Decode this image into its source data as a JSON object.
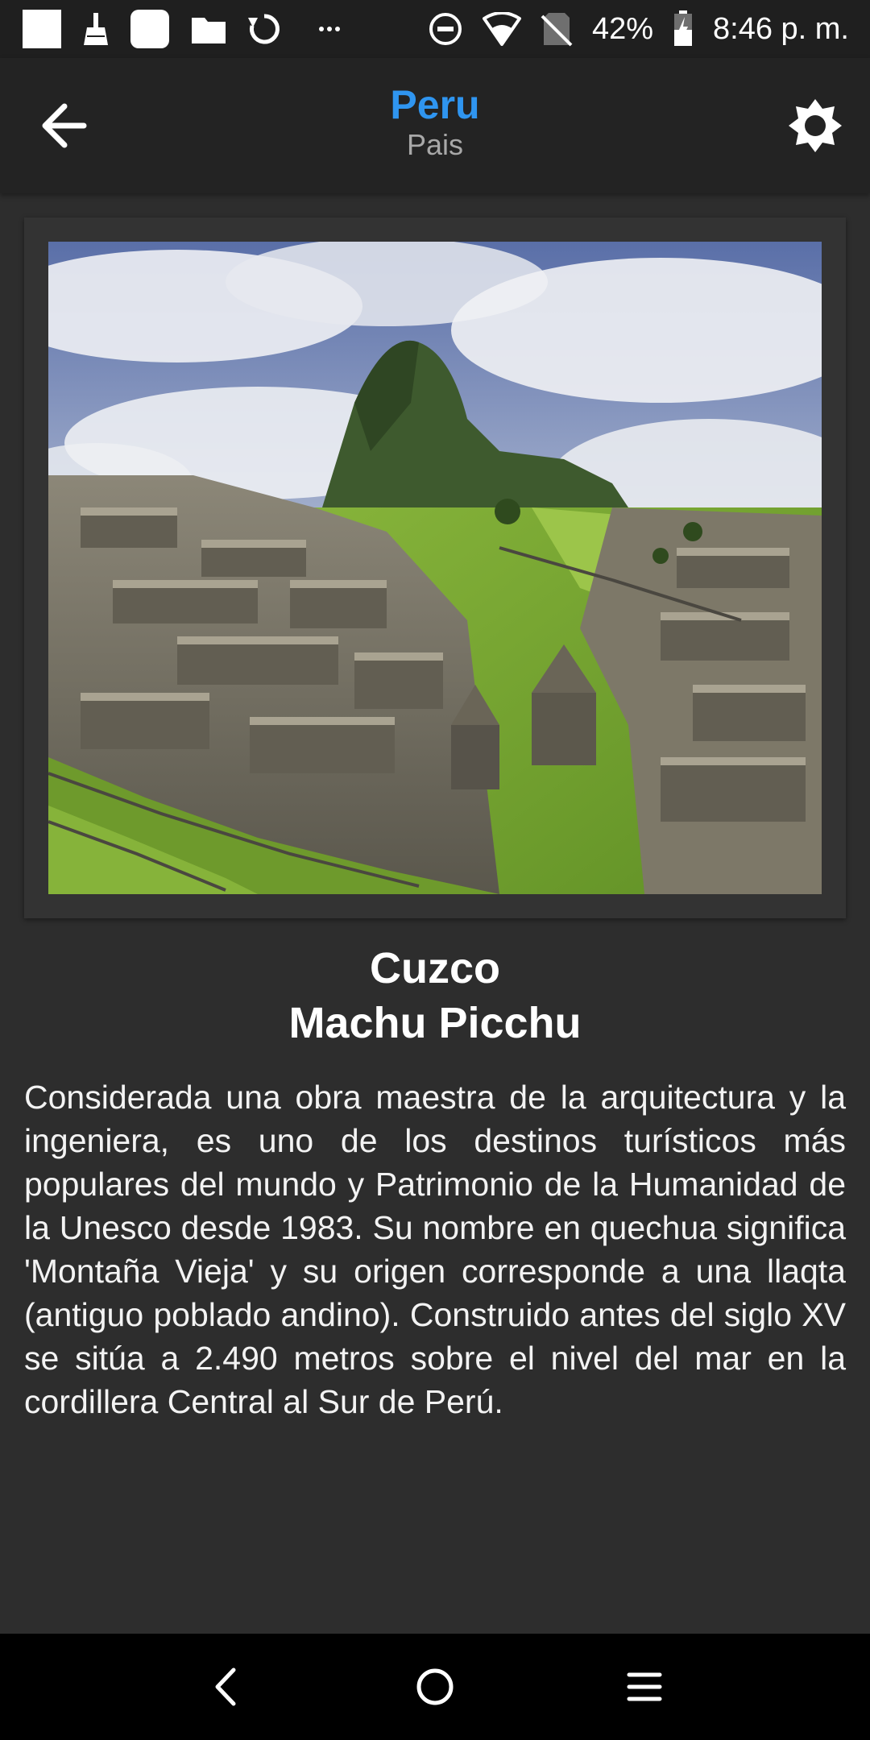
{
  "status_bar": {
    "left_icons": [
      "notification-square-icon",
      "broom-icon",
      "app-square-icon",
      "folder-icon",
      "sync-icon",
      "more-notifications-icon"
    ],
    "right_icons": [
      "do-not-disturb-icon",
      "wifi-icon",
      "no-sim-icon",
      "battery-charging-icon"
    ],
    "battery": "42%",
    "time": "8:46 p. m."
  },
  "app_bar": {
    "title": "Peru",
    "subtitle": "Pais",
    "back_icon": "arrow-back-icon",
    "settings_icon": "brightness-icon",
    "title_color": "#2f95f0"
  },
  "place": {
    "image_icon": "machu-picchu-photo",
    "region": "Cuzco",
    "name": "Machu Picchu",
    "description": "Considerada una obra maestra de la arquitectura y la ingeniera, es uno de los destinos turísticos más populares del mundo y Patrimonio de la Humanidad de la Unesco desde 1983. Su nombre en quechua significa 'Montaña Vieja' y su origen corresponde a una llaqta (antiguo poblado andino). Construido antes del siglo XV se sitúa a 2.490 metros sobre el nivel del mar en la cordillera Central al Sur de Perú."
  },
  "nav_bar": {
    "icons": [
      "nav-back-icon",
      "nav-home-icon",
      "nav-menu-icon"
    ]
  }
}
